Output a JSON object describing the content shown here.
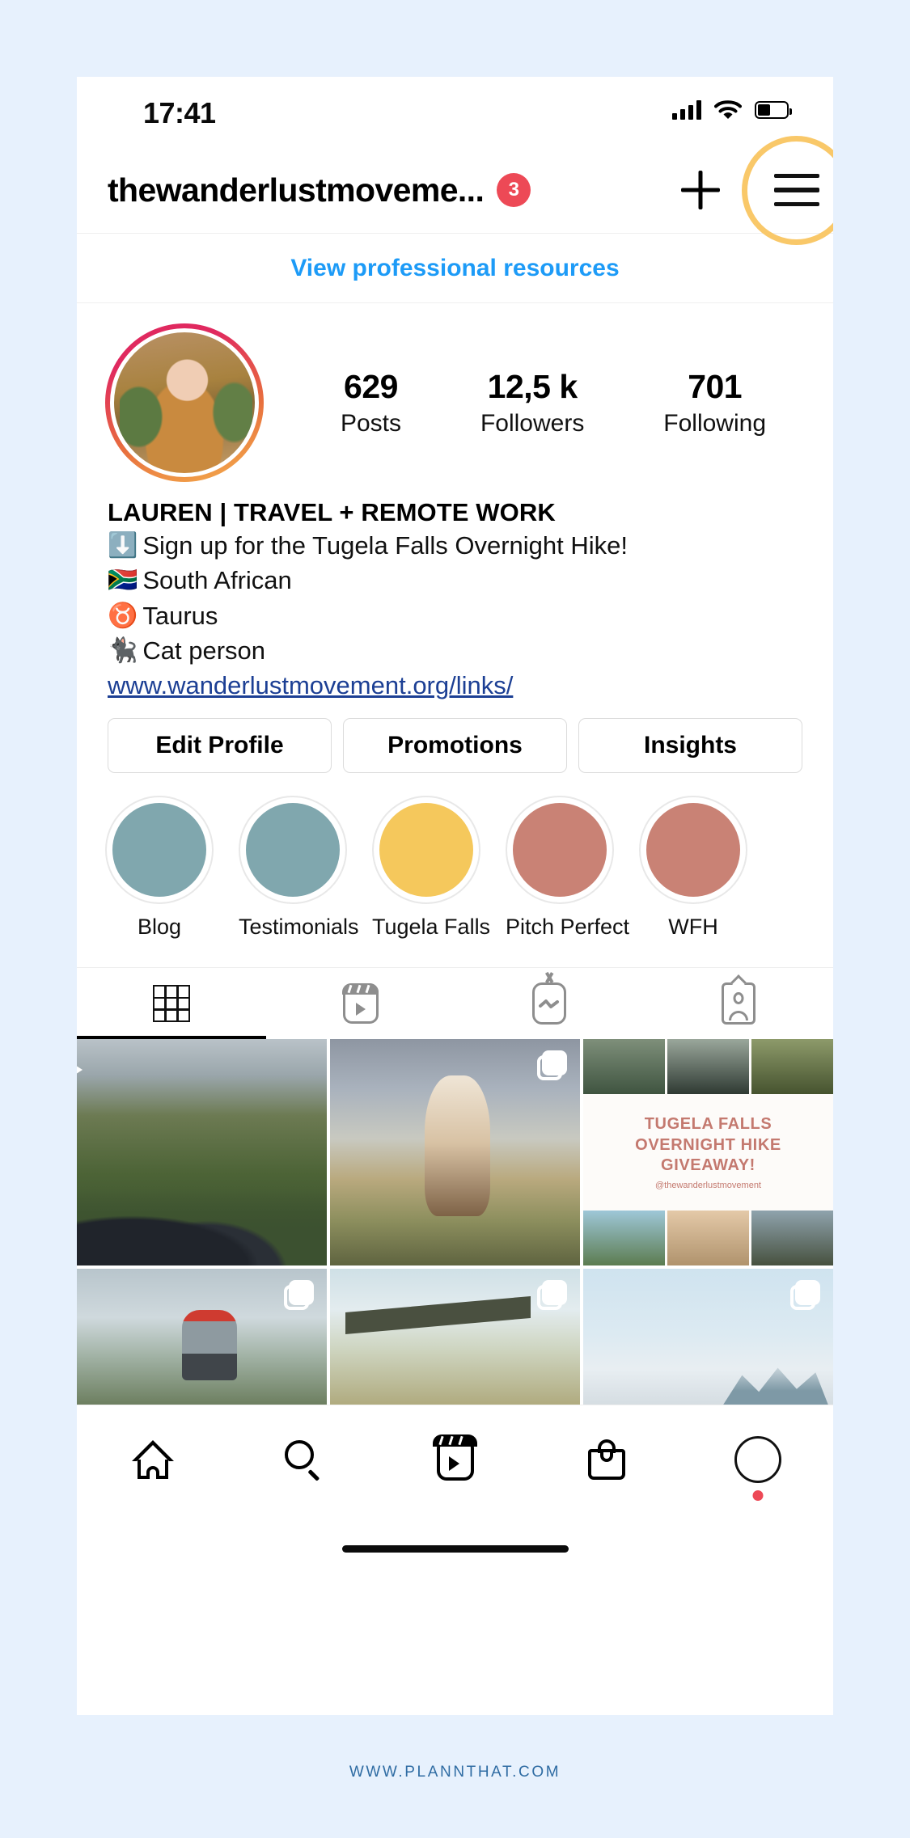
{
  "background_color": "#e7f1fd",
  "status_bar": {
    "time": "17:41",
    "signal_icon": "cellular-signal-icon",
    "wifi_icon": "wifi-icon",
    "battery_icon": "battery-icon",
    "battery_level_percent": 45
  },
  "app_bar": {
    "username": "thewanderlustmoveme...",
    "notification_badge": "3",
    "badge_color": "#ed4956",
    "add_icon": "plus-icon",
    "menu_icon": "hamburger-menu-icon",
    "menu_highlight_color": "#f9c869"
  },
  "professional": {
    "link_label": "View professional resources",
    "link_color": "#1d9bf7"
  },
  "profile": {
    "avatar_icon": "profile-avatar",
    "stats": [
      {
        "value": "629",
        "label": "Posts"
      },
      {
        "value": "12,5 k",
        "label": "Followers"
      },
      {
        "value": "701",
        "label": "Following"
      }
    ],
    "bio_name": "LAUREN | TRAVEL + REMOTE WORK",
    "bio_lines": [
      {
        "emoji": "⬇️",
        "text": "Sign up for the Tugela Falls Overnight Hike!"
      },
      {
        "emoji": "🇿🇦",
        "text": "South African"
      },
      {
        "emoji": "♉",
        "text": "Taurus"
      },
      {
        "emoji": "🐈‍⬛",
        "text": "Cat person"
      }
    ],
    "website": "www.wanderlustmovement.org/links/",
    "website_color": "#1c3f94"
  },
  "action_buttons": [
    {
      "label": "Edit Profile"
    },
    {
      "label": "Promotions"
    },
    {
      "label": "Insights"
    }
  ],
  "highlights": [
    {
      "label": "Blog",
      "color": "#80a7ae"
    },
    {
      "label": "Testimonials",
      "color": "#80a7ae"
    },
    {
      "label": "Tugela Falls",
      "color": "#f5c köp"
    },
    {
      "label": "Pitch Perfect",
      "color": "#c98275"
    },
    {
      "label": "WFH",
      "color": "#c98275"
    }
  ],
  "tabs": [
    {
      "icon": "grid-icon",
      "active": true
    },
    {
      "icon": "reels-icon",
      "active": false
    },
    {
      "icon": "igtv-icon",
      "active": false
    },
    {
      "icon": "tagged-icon",
      "active": false
    }
  ],
  "grid_posts": [
    {
      "name": "post-canyon-viewpoint",
      "overlay_icon": "reel-icon"
    },
    {
      "name": "post-woman-on-jeep",
      "overlay_icon": "carousel-icon"
    },
    {
      "name": "post-giveaway-graphic",
      "overlay_icon": "none",
      "graphic": {
        "title_lines": [
          "TUGELA FALLS",
          "OVERNIGHT HIKE",
          "GIVEAWAY!"
        ],
        "handle": "@thewanderlustmovement",
        "text_color": "#c4796f"
      }
    },
    {
      "name": "post-hiker-backpack",
      "overlay_icon": "carousel-icon"
    },
    {
      "name": "post-woman-under-shelter",
      "overlay_icon": "carousel-icon"
    },
    {
      "name": "post-sky-mountains",
      "overlay_icon": "carousel-icon"
    }
  ],
  "bottom_nav": [
    {
      "name": "home",
      "icon": "home-icon"
    },
    {
      "name": "search",
      "icon": "search-icon"
    },
    {
      "name": "reels",
      "icon": "reels-icon"
    },
    {
      "name": "shop",
      "icon": "shop-bag-icon"
    },
    {
      "name": "profile",
      "icon": "profile-avatar-icon",
      "dot": true
    }
  ],
  "footer": {
    "watermark": "WWW.PLANNTHAT.COM",
    "color": "#2f6ca3"
  }
}
